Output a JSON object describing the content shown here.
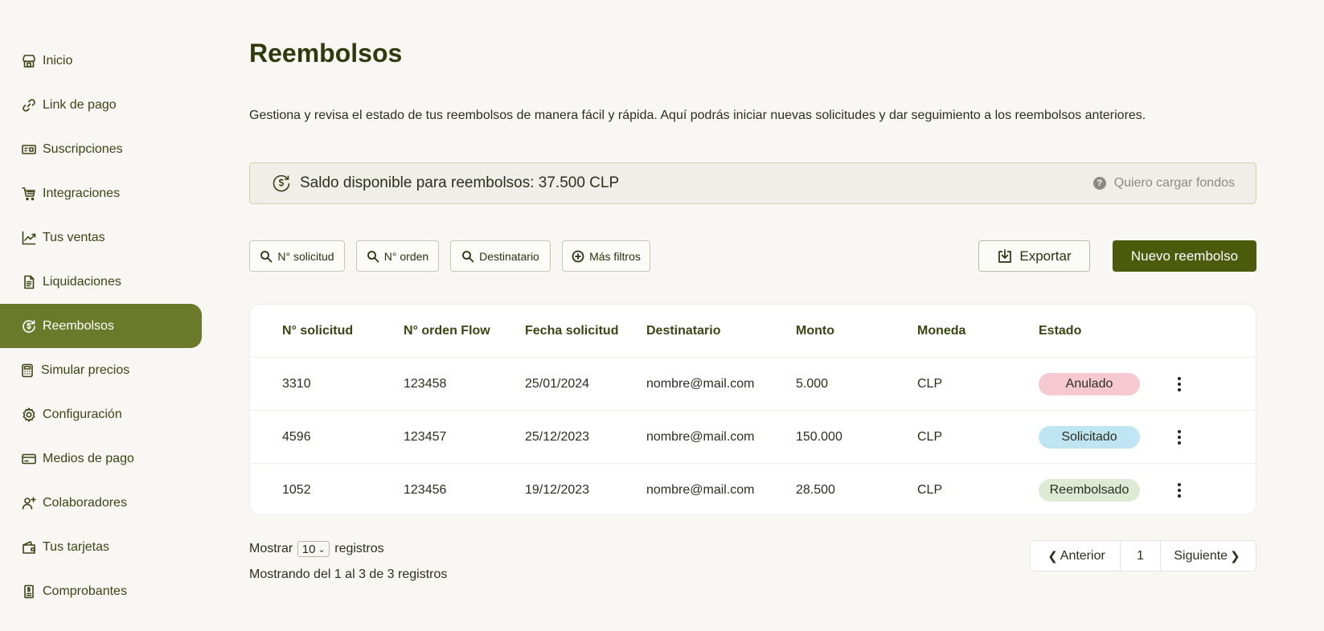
{
  "sidebar": {
    "items": [
      {
        "label": "Inicio",
        "icon": "store-icon"
      },
      {
        "label": "Link de pago",
        "icon": "link-icon"
      },
      {
        "label": "Suscripciones",
        "icon": "subscriptions-icon"
      },
      {
        "label": "Integraciones",
        "icon": "cart-icon"
      },
      {
        "label": "Tus ventas",
        "icon": "chart-line-icon"
      },
      {
        "label": "Liquidaciones",
        "icon": "document-icon"
      },
      {
        "label": "Reembolsos",
        "icon": "refund-icon",
        "active": true
      },
      {
        "label": "Simular precios",
        "icon": "calculator-icon"
      },
      {
        "label": "Configuración",
        "icon": "gear-icon"
      },
      {
        "label": "Medios de pago",
        "icon": "credit-card-icon"
      },
      {
        "label": "Colaboradores",
        "icon": "user-plus-icon"
      },
      {
        "label": "Tus tarjetas",
        "icon": "wallet-icon"
      },
      {
        "label": "Comprobantes",
        "icon": "receipt-icon"
      }
    ]
  },
  "page": {
    "title": "Reembolsos",
    "description": "Gestiona y revisa el estado de tus reembolsos de manera fácil y rápida. Aquí podrás iniciar nuevas solicitudes y dar seguimiento a los reembolsos anteriores."
  },
  "balance": {
    "text": "Saldo disponible para reembolsos: 37.500 CLP",
    "help_label": "Quiero cargar fondos"
  },
  "filters": {
    "solicitud": "N° solicitud",
    "orden": "N° orden",
    "destinatario": "Destinatario",
    "mas": "Más filtros"
  },
  "actions": {
    "export_label": "Exportar",
    "new_label": "Nuevo reembolso"
  },
  "table": {
    "headers": {
      "solicitud": "N° solicitud",
      "orden": "N° orden Flow",
      "fecha": "Fecha solicitud",
      "destinatario": "Destinatario",
      "monto": "Monto",
      "moneda": "Moneda",
      "estado": "Estado"
    },
    "rows": [
      {
        "solicitud": "3310",
        "orden": "123458",
        "fecha": "25/01/2024",
        "destinatario": "nombre@mail.com",
        "monto": "5.000",
        "moneda": "CLP",
        "estado": "Anulado"
      },
      {
        "solicitud": "4596",
        "orden": "123457",
        "fecha": "25/12/2023",
        "destinatario": "nombre@mail.com",
        "monto": "150.000",
        "moneda": "CLP",
        "estado": "Solicitado"
      },
      {
        "solicitud": "1052",
        "orden": "123456",
        "fecha": "19/12/2023",
        "destinatario": "nombre@mail.com",
        "monto": "28.500",
        "moneda": "CLP",
        "estado": "Reembolsado"
      }
    ]
  },
  "status_colors": {
    "Anulado": "#f6c9d2",
    "Solicitado": "#bfe4f2",
    "Reembolsado": "#dfead5"
  },
  "footer": {
    "show_label": "Mostrar",
    "page_size": "10",
    "records_label": "registros",
    "summary": "Mostrando del 1 al 3 de 3 registros"
  },
  "pager": {
    "prev": "Anterior",
    "current": "1",
    "next": "Siguiente"
  }
}
